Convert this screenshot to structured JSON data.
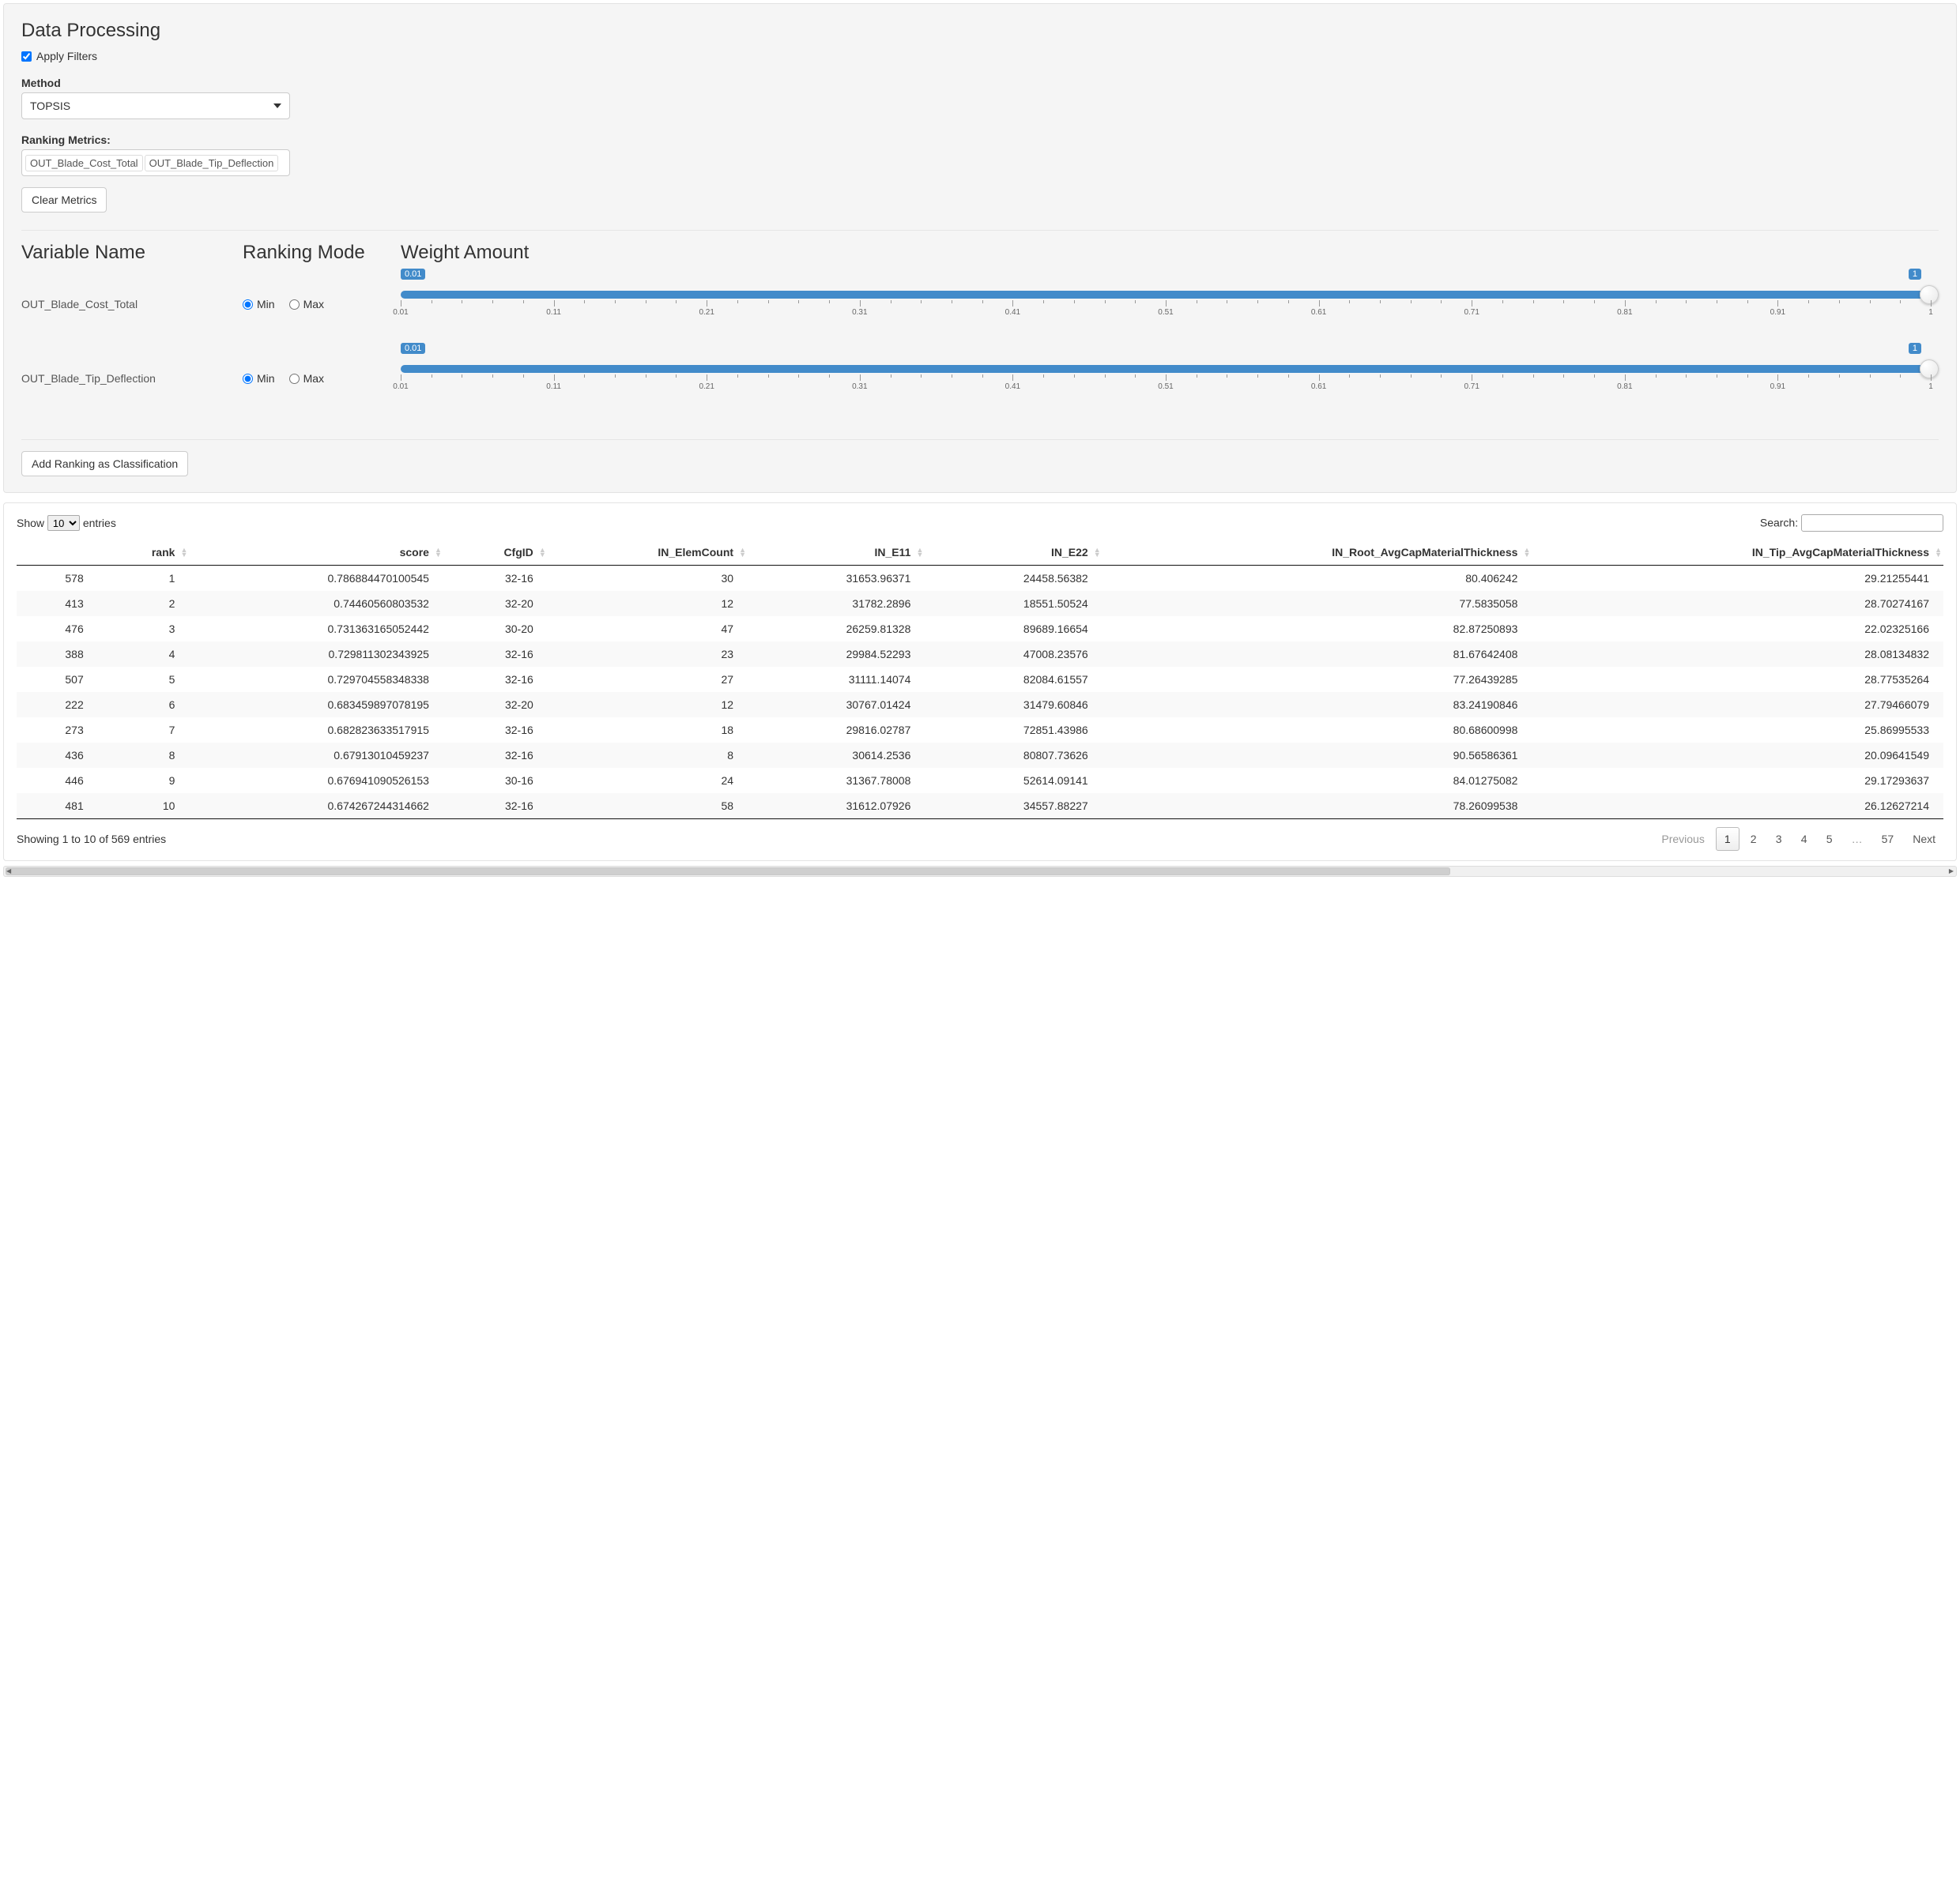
{
  "section": {
    "title": "Data Processing",
    "apply_filters_label": "Apply Filters",
    "apply_filters_checked": true,
    "method_label": "Method",
    "method_value": "TOPSIS",
    "ranking_metrics_label": "Ranking Metrics:",
    "ranking_metrics_tags": [
      "OUT_Blade_Cost_Total",
      "OUT_Blade_Tip_Deflection"
    ],
    "clear_metrics_label": "Clear Metrics",
    "add_ranking_label": "Add Ranking as Classification",
    "col_variable_name": "Variable Name",
    "col_ranking_mode": "Ranking Mode",
    "col_weight_amount": "Weight Amount",
    "mode_min_label": "Min",
    "mode_max_label": "Max",
    "variables": [
      {
        "name": "OUT_Blade_Cost_Total",
        "mode": "Min",
        "min_badge": "0.01",
        "max_badge": "1",
        "weight": 1
      },
      {
        "name": "OUT_Blade_Tip_Deflection",
        "mode": "Min",
        "min_badge": "0.01",
        "max_badge": "1",
        "weight": 1
      }
    ],
    "slider_tick_labels": [
      "0.01",
      "0.11",
      "0.21",
      "0.31",
      "0.41",
      "0.51",
      "0.61",
      "0.71",
      "0.81",
      "0.91",
      "1"
    ]
  },
  "table": {
    "show_prefix": "Show",
    "show_value": "10",
    "show_suffix": "entries",
    "search_label": "Search:",
    "search_value": "",
    "columns": [
      "",
      "rank",
      "score",
      "CfgID",
      "IN_ElemCount",
      "IN_E11",
      "IN_E22",
      "IN_Root_AvgCapMaterialThickness",
      "IN_Tip_AvgCapMaterialThickness"
    ],
    "rows": [
      {
        "idx": "578",
        "rank": "1",
        "score": "0.786884470100545",
        "cfg": "32-16",
        "elem": "30",
        "e11": "31653.96371",
        "e22": "24458.56382",
        "root": "80.406242",
        "tip": "29.21255441"
      },
      {
        "idx": "413",
        "rank": "2",
        "score": "0.74460560803532",
        "cfg": "32-20",
        "elem": "12",
        "e11": "31782.2896",
        "e22": "18551.50524",
        "root": "77.5835058",
        "tip": "28.70274167"
      },
      {
        "idx": "476",
        "rank": "3",
        "score": "0.731363165052442",
        "cfg": "30-20",
        "elem": "47",
        "e11": "26259.81328",
        "e22": "89689.16654",
        "root": "82.87250893",
        "tip": "22.02325166"
      },
      {
        "idx": "388",
        "rank": "4",
        "score": "0.729811302343925",
        "cfg": "32-16",
        "elem": "23",
        "e11": "29984.52293",
        "e22": "47008.23576",
        "root": "81.67642408",
        "tip": "28.08134832"
      },
      {
        "idx": "507",
        "rank": "5",
        "score": "0.729704558348338",
        "cfg": "32-16",
        "elem": "27",
        "e11": "31111.14074",
        "e22": "82084.61557",
        "root": "77.26439285",
        "tip": "28.77535264"
      },
      {
        "idx": "222",
        "rank": "6",
        "score": "0.683459897078195",
        "cfg": "32-20",
        "elem": "12",
        "e11": "30767.01424",
        "e22": "31479.60846",
        "root": "83.24190846",
        "tip": "27.79466079"
      },
      {
        "idx": "273",
        "rank": "7",
        "score": "0.682823633517915",
        "cfg": "32-16",
        "elem": "18",
        "e11": "29816.02787",
        "e22": "72851.43986",
        "root": "80.68600998",
        "tip": "25.86995533"
      },
      {
        "idx": "436",
        "rank": "8",
        "score": "0.67913010459237",
        "cfg": "32-16",
        "elem": "8",
        "e11": "30614.2536",
        "e22": "80807.73626",
        "root": "90.56586361",
        "tip": "20.09641549"
      },
      {
        "idx": "446",
        "rank": "9",
        "score": "0.676941090526153",
        "cfg": "30-16",
        "elem": "24",
        "e11": "31367.78008",
        "e22": "52614.09141",
        "root": "84.01275082",
        "tip": "29.17293637"
      },
      {
        "idx": "481",
        "rank": "10",
        "score": "0.674267244314662",
        "cfg": "32-16",
        "elem": "58",
        "e11": "31612.07926",
        "e22": "34557.88227",
        "root": "78.26099538",
        "tip": "26.12627214"
      }
    ],
    "info": "Showing 1 to 10 of 569 entries",
    "pagination": {
      "previous": "Previous",
      "next": "Next",
      "pages": [
        "1",
        "2",
        "3",
        "4",
        "5",
        "…",
        "57"
      ],
      "current": "1"
    }
  }
}
